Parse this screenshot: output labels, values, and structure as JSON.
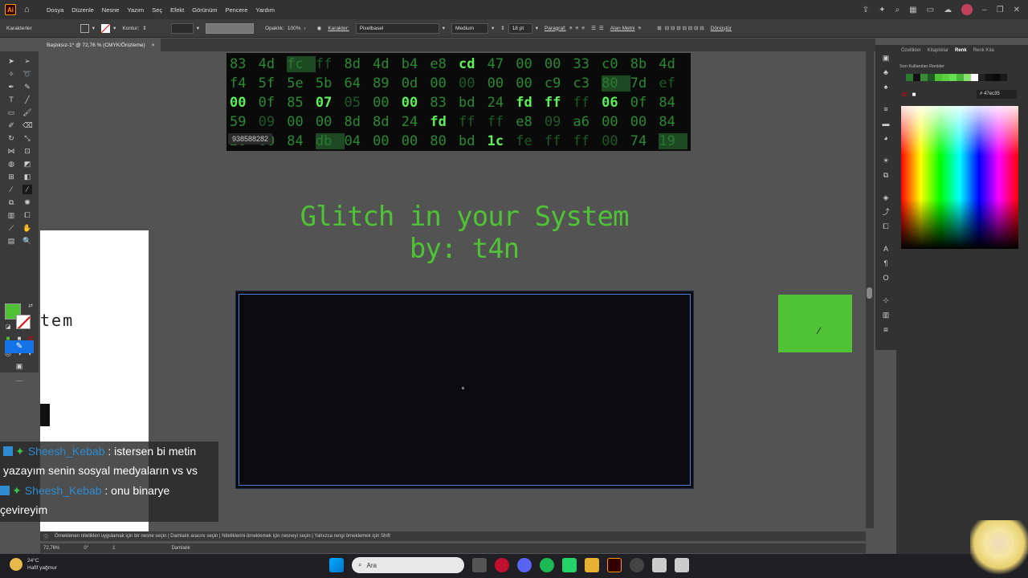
{
  "menubar": {
    "logo": "Ai",
    "items": [
      "Dosya",
      "Düzenle",
      "Nesne",
      "Yazım",
      "Seç",
      "Efekt",
      "Görünüm",
      "Pencere",
      "Yardım"
    ]
  },
  "control_bar": {
    "panel_name": "Karakterler",
    "stroke_label": "Kontur:",
    "opacity_label": "Opaklık:",
    "opacity_value": "100%",
    "character_label": "Karakter:",
    "font_family": "Pixelbasel",
    "font_style": "Medium",
    "font_size": "18 pt",
    "paragraph_label": "Paragraf:",
    "area_text_label": "Alan Metni",
    "transform_label": "Dönüştür"
  },
  "document_tab": {
    "title": "Başlıksız-1* @ 72,76 % (CMYK/Önizleme)",
    "close": "×"
  },
  "artboard": {
    "hex_rows": [
      [
        "83",
        "4d",
        "fc",
        "ff",
        "8d",
        "4d",
        "b4",
        "e8",
        "cd",
        "47",
        "00",
        "00",
        "33",
        "c0",
        "8b",
        "4d"
      ],
      [
        "f4",
        "5f",
        "5e",
        "5b",
        "64",
        "89",
        "0d",
        "00",
        "00",
        "00",
        "00",
        "c9",
        "c3",
        "80",
        "7d",
        "ef"
      ],
      [
        "00",
        "0f",
        "85",
        "07",
        "05",
        "00",
        "00",
        "83",
        "bd",
        "24",
        "fd",
        "ff",
        "ff",
        "06",
        "0f",
        "84"
      ],
      [
        "59",
        "09",
        "00",
        "00",
        "8d",
        "8d",
        "24",
        "fd",
        "ff",
        "ff",
        "e8",
        "09",
        "a6",
        "00",
        "00",
        "84"
      ],
      [
        "28",
        "00",
        "84",
        "db",
        "04",
        "00",
        "00",
        "80",
        "bd",
        "1c",
        "fe",
        "ff",
        "ff",
        "00",
        "74",
        "19"
      ]
    ],
    "hex_label": "938588282",
    "title_line1": "Glitch in your System",
    "title_line2": "by: t4n",
    "accent_color": "#4fc235"
  },
  "overlay_fragment": {
    "text": "tem"
  },
  "chat": {
    "messages": [
      {
        "user": "Sheesh_Kebab",
        "text": ": istersen bi metin",
        "cont": "yazayım senin sosyal medyaların vs vs"
      },
      {
        "user": "Sheesh_Kebab",
        "text": ": onu binarye",
        "cont": "çevireyim"
      }
    ]
  },
  "right_panel": {
    "tabs": [
      "Özellikler",
      "Kitaplıklar",
      "Renk",
      "Renk Kıla"
    ],
    "active_tab": "Renk",
    "recent_label": "Son Kullanılan Renkler",
    "hex_value": "47ec35"
  },
  "status": {
    "hint": "Örneklenen nitelikleri uygulamak için bir nesne seçin  |  Damlalık aracını seçin  |  Niteliklerini örneklemek için nesneyi seçin  |  Yalnızca rengi örneklemek için Shift",
    "zoom": "72,76%",
    "rotation": "0°",
    "artboard_num": "1",
    "tool_name": "Damlalık"
  },
  "taskbar": {
    "temp": "24°C",
    "weather": "Hafif yağmur",
    "search_placeholder": "Ara"
  }
}
